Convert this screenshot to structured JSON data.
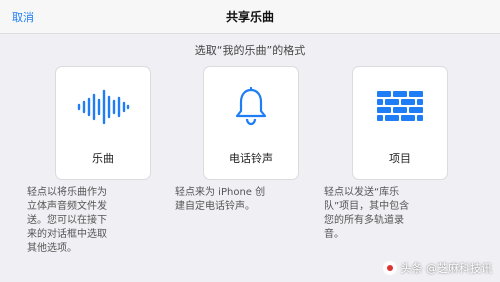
{
  "navbar": {
    "cancel_label": "取消",
    "title": "共享乐曲"
  },
  "prompt": "选取“我的乐曲”的格式",
  "options": [
    {
      "label": "乐曲",
      "icon": "waveform-icon",
      "description": "轻点以将乐曲作为\n立体声音频文件发\n送。您可以在接下\n来的对话框中选取\n其他选项。"
    },
    {
      "label": "电话铃声",
      "icon": "bell-icon",
      "description": "轻点来为 iPhone 创\n建自定电话铃声。"
    },
    {
      "label": "项目",
      "icon": "bricks-icon",
      "description": "轻点以发送“库乐\n队”项目，其中包含\n您的所有多轨道录\n音。"
    }
  ],
  "watermark": "头条 @芝麻科技讯",
  "colors": {
    "accent": "#1f7ef5",
    "background": "#f0eff4",
    "card": "#ffffff"
  }
}
